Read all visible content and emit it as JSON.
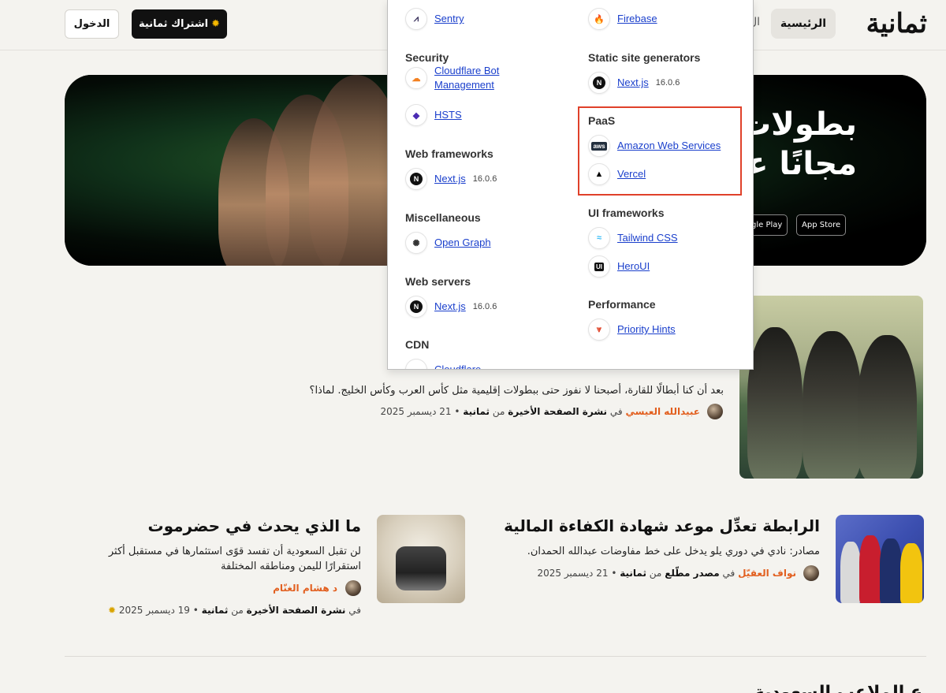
{
  "header": {
    "logo": "ثمانية",
    "nav_home": "الرئيسية",
    "nav_next": "ال",
    "subscribe_label": "اشتراك ثمانية",
    "login_label": "الدخول"
  },
  "hero": {
    "line1": "بطولات",
    "line2": "مجانًا على",
    "app_store": "App Store",
    "google_play": "Google Play"
  },
  "articles": [
    {
      "title": "",
      "desc": "بعد أن كنا أبطالًا للقارة، أصبحنا لا نفوز حتى ببطولات إقليمية مثل كأس العرب وكأس الخليج. لماذا؟",
      "author": "عبيدالله العيسي",
      "in_word": "في",
      "publication": "نشرة الصفحة الأخيرة",
      "from_word": "من",
      "brand": "ثمانية",
      "date": "21 ديسمبر 2025"
    },
    {
      "title": "الرابطة تعدِّل موعد شهادة الكفاءة المالية",
      "desc": "مصادر: نادي في دوري يلو يدخل على خط مفاوضات عبدالله الحمدان.",
      "author": "نواف العقيّل",
      "in_word": "في",
      "publication": "مصدر مطّلع",
      "from_word": "من",
      "brand": "ثمانية",
      "date": "21 ديسمبر 2025"
    },
    {
      "title": "ما الذي يحدث في حضرموت",
      "desc": "لن تقبل السعودية أن تفسد قوًى استثمارها في مستقبل أكثر استقرارًا لليمن ومناطقه المختلفة",
      "author": "د هشام الغنّام",
      "in_word": "في",
      "publication": "نشرة الصفحة الأخيرة",
      "from_word": "من",
      "brand": "ثمانية",
      "date": "19 ديسمبر 2025"
    }
  ],
  "bottom_title": "ع الملاعب السعودية",
  "wappalyzer": {
    "left": [
      {
        "type": "tech",
        "name": "Sentry",
        "icon": "sentry-icon"
      },
      {
        "type": "cat",
        "name": "Security"
      },
      {
        "type": "tech",
        "name": "Cloudflare Bot Management",
        "icon": "cloudflare-icon"
      },
      {
        "type": "tech",
        "name": "HSTS",
        "icon": "hsts-icon"
      },
      {
        "type": "cat",
        "name": "Web frameworks"
      },
      {
        "type": "tech",
        "name": "Next.js",
        "version": "16.0.6",
        "icon": "nextjs-icon"
      },
      {
        "type": "cat",
        "name": "Miscellaneous"
      },
      {
        "type": "tech",
        "name": "Open Graph",
        "icon": "open-graph-icon"
      },
      {
        "type": "cat",
        "name": "Web servers"
      },
      {
        "type": "tech",
        "name": "Next.js",
        "version": "16.0.6",
        "icon": "nextjs-icon"
      },
      {
        "type": "cat",
        "name": "CDN"
      },
      {
        "type": "tech",
        "name": "Cloudflare",
        "icon": "cloudflare-icon"
      }
    ],
    "right": [
      {
        "type": "tech",
        "name": "Firebase",
        "icon": "firebase-icon"
      },
      {
        "type": "cat",
        "name": "Static site generators"
      },
      {
        "type": "tech",
        "name": "Next.js",
        "version": "16.0.6",
        "icon": "nextjs-icon"
      },
      {
        "type": "cat",
        "name": "PaaS"
      },
      {
        "type": "tech",
        "name": "Amazon Web Services",
        "icon": "aws-icon"
      },
      {
        "type": "tech",
        "name": "Vercel",
        "icon": "vercel-icon"
      },
      {
        "type": "cat",
        "name": "UI frameworks"
      },
      {
        "type": "tech",
        "name": "Tailwind CSS",
        "icon": "tailwind-icon"
      },
      {
        "type": "tech",
        "name": "HeroUI",
        "icon": "heroui-icon"
      },
      {
        "type": "cat",
        "name": "Performance"
      },
      {
        "type": "tech",
        "name": "Priority Hints",
        "icon": "priority-hints-icon"
      }
    ]
  },
  "colors": {
    "accent_author": "#e25f1f",
    "link_blue": "#1a3fcc",
    "highlight_red": "#e0412a",
    "subscribe_bg": "#111111"
  }
}
